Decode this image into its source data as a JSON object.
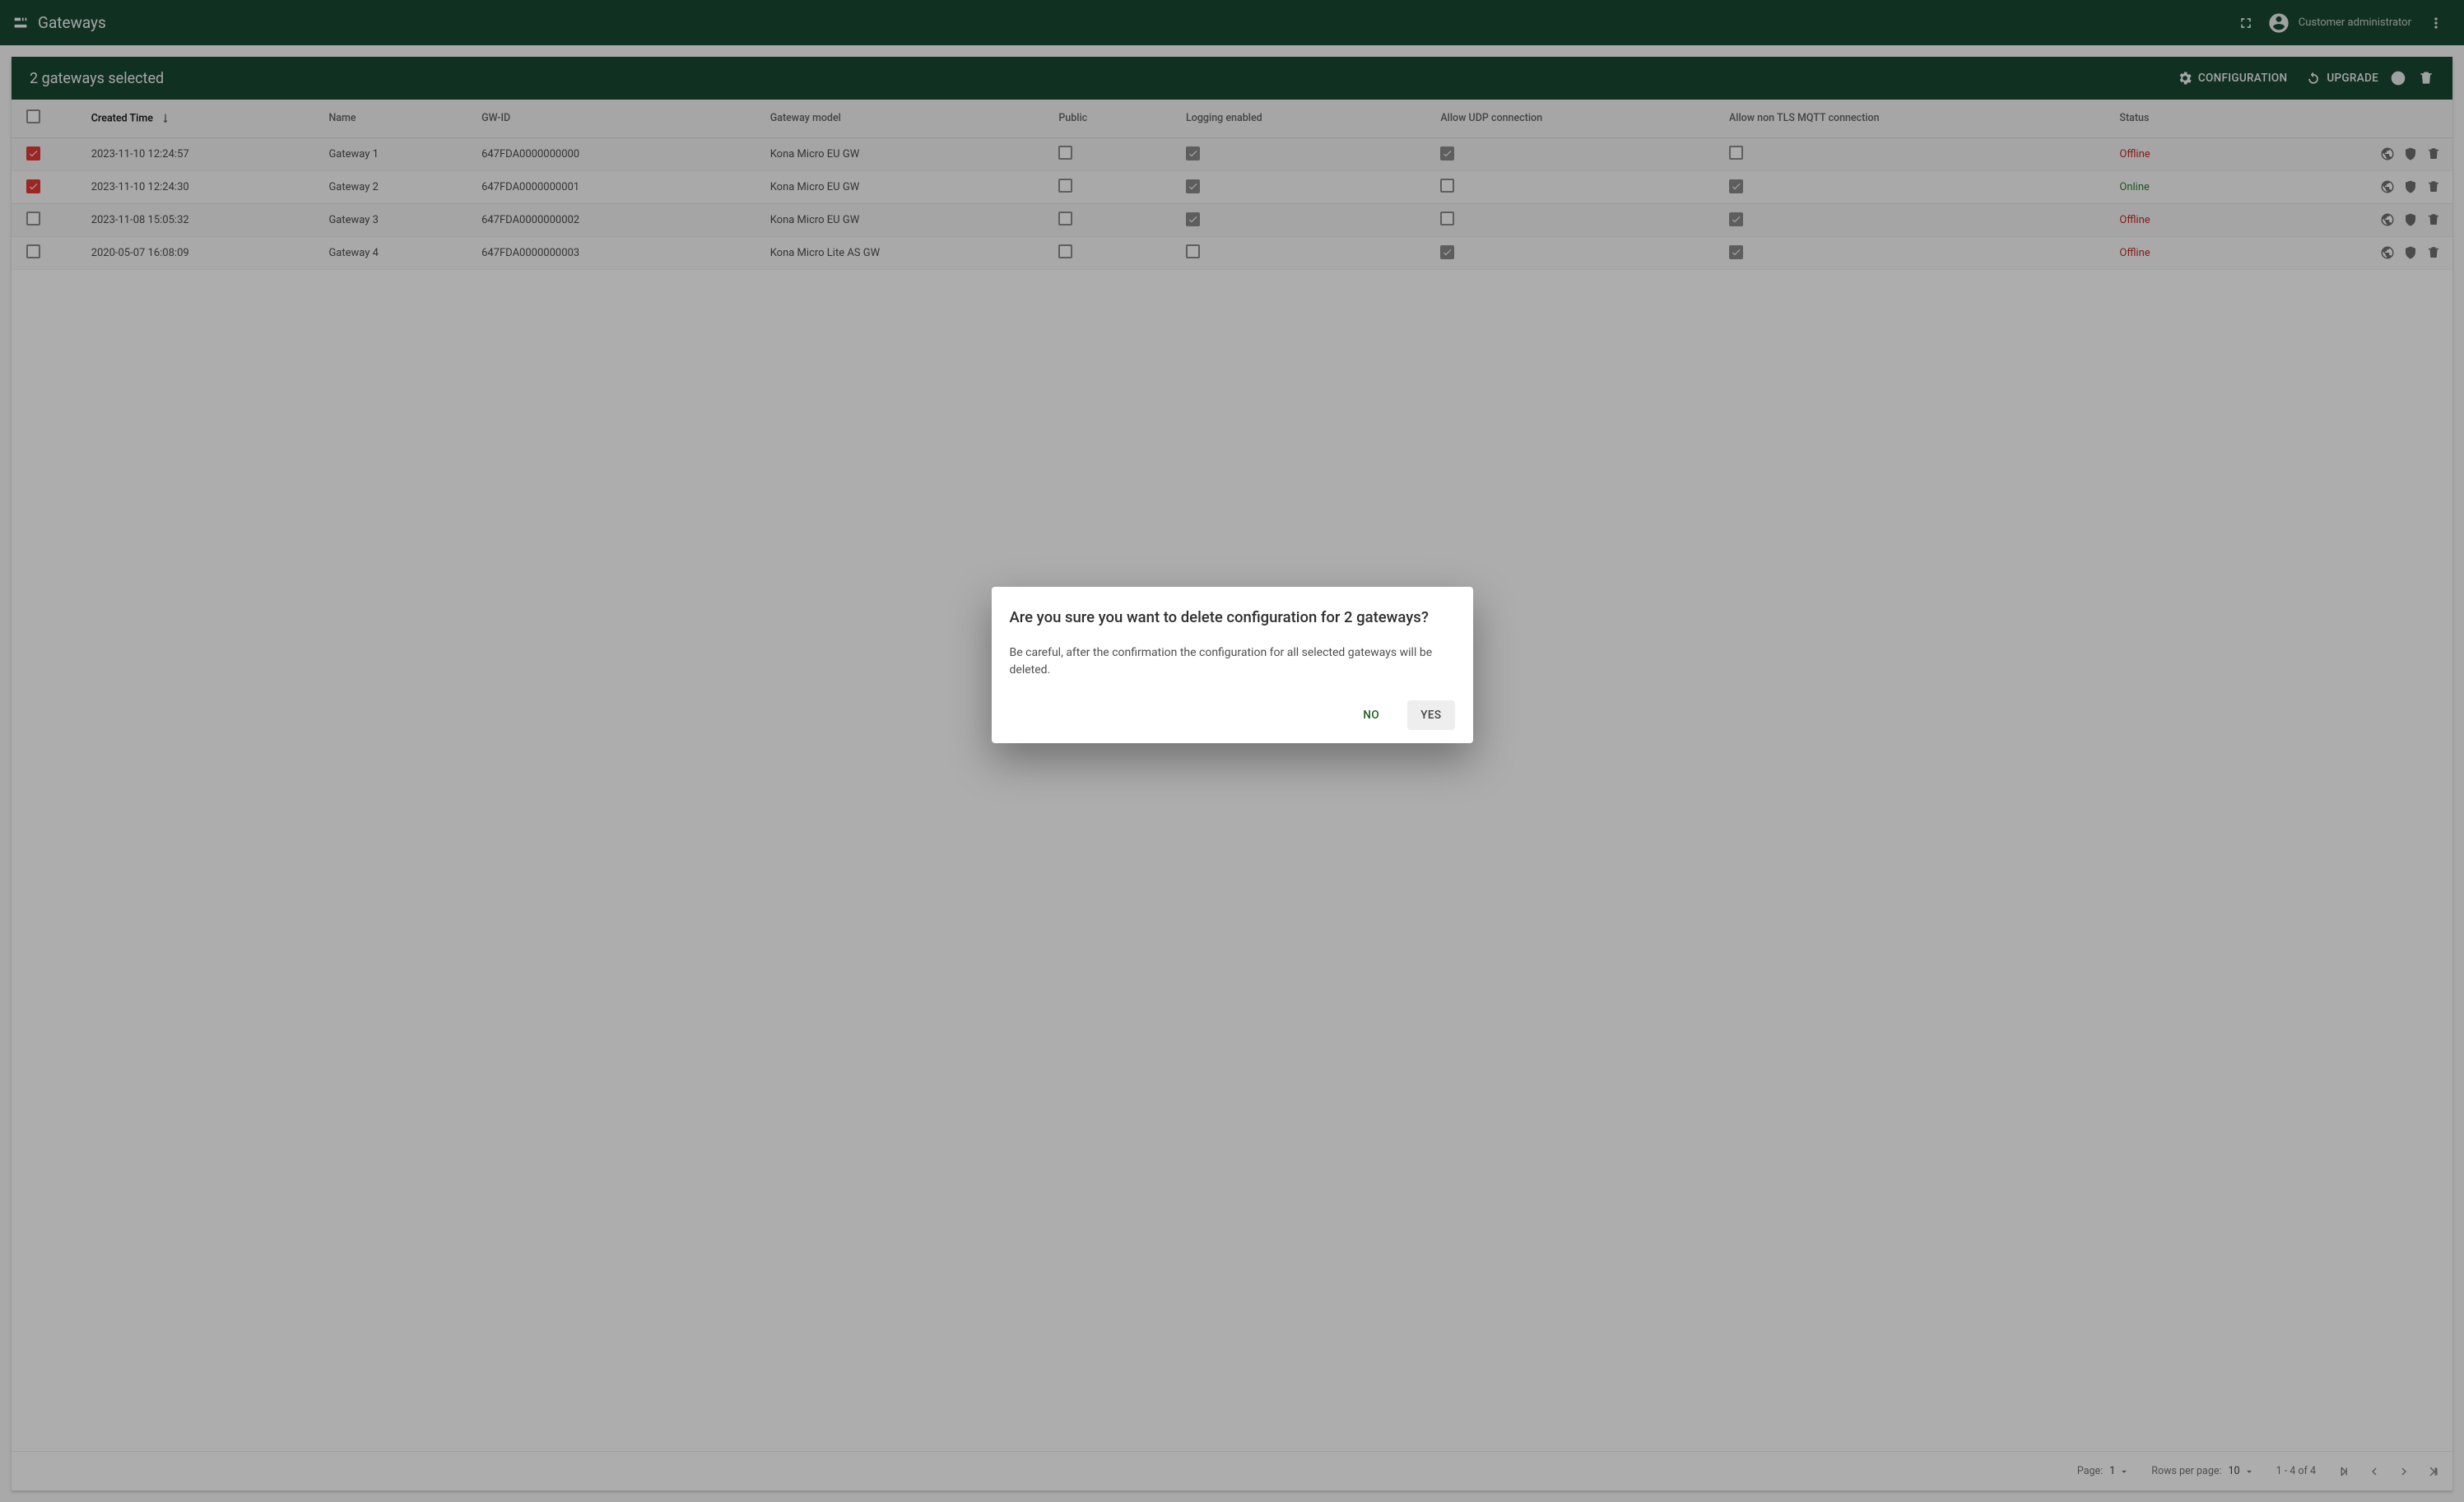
{
  "appbar": {
    "title": "Gateways",
    "username": "Customer administrator"
  },
  "card": {
    "selection_title": "2 gateways selected",
    "buttons": {
      "configuration": "CONFIGURATION",
      "upgrade": "UPGRADE"
    }
  },
  "columns": {
    "created_time": "Created Time",
    "name": "Name",
    "gw_id": "GW-ID",
    "model": "Gateway model",
    "public": "Public",
    "logging": "Logging enabled",
    "udp": "Allow UDP connection",
    "mqtt": "Allow non TLS MQTT connection",
    "status": "Status"
  },
  "rows": [
    {
      "selected": true,
      "created": "2023-11-10 12:24:57",
      "name": "Gateway 1",
      "gwid": "647FDA0000000000",
      "model": "Kona Micro EU GW",
      "public": false,
      "logging": true,
      "udp": true,
      "mqtt": false,
      "status": "Offline"
    },
    {
      "selected": true,
      "created": "2023-11-10 12:24:30",
      "name": "Gateway 2",
      "gwid": "647FDA0000000001",
      "model": "Kona Micro EU GW",
      "public": false,
      "logging": true,
      "udp": false,
      "mqtt": true,
      "status": "Online"
    },
    {
      "selected": false,
      "created": "2023-11-08 15:05:32",
      "name": "Gateway 3",
      "gwid": "647FDA0000000002",
      "model": "Kona Micro EU GW",
      "public": false,
      "logging": true,
      "udp": false,
      "mqtt": true,
      "status": "Offline"
    },
    {
      "selected": false,
      "created": "2020-05-07 16:08:09",
      "name": "Gateway 4",
      "gwid": "647FDA0000000003",
      "model": "Kona Micro Lite AS GW",
      "public": false,
      "logging": false,
      "udp": true,
      "mqtt": true,
      "status": "Offline"
    }
  ],
  "paginator": {
    "page_label": "Page:",
    "page_value": "1",
    "rows_label": "Rows per page:",
    "rows_value": "10",
    "range": "1 - 4 of 4"
  },
  "dialog": {
    "title": "Are you sure you want to delete configuration for 2 gateways?",
    "body": "Be careful, after the confirmation the configuration for all selected gateways will be deleted.",
    "no": "NO",
    "yes": "YES"
  }
}
